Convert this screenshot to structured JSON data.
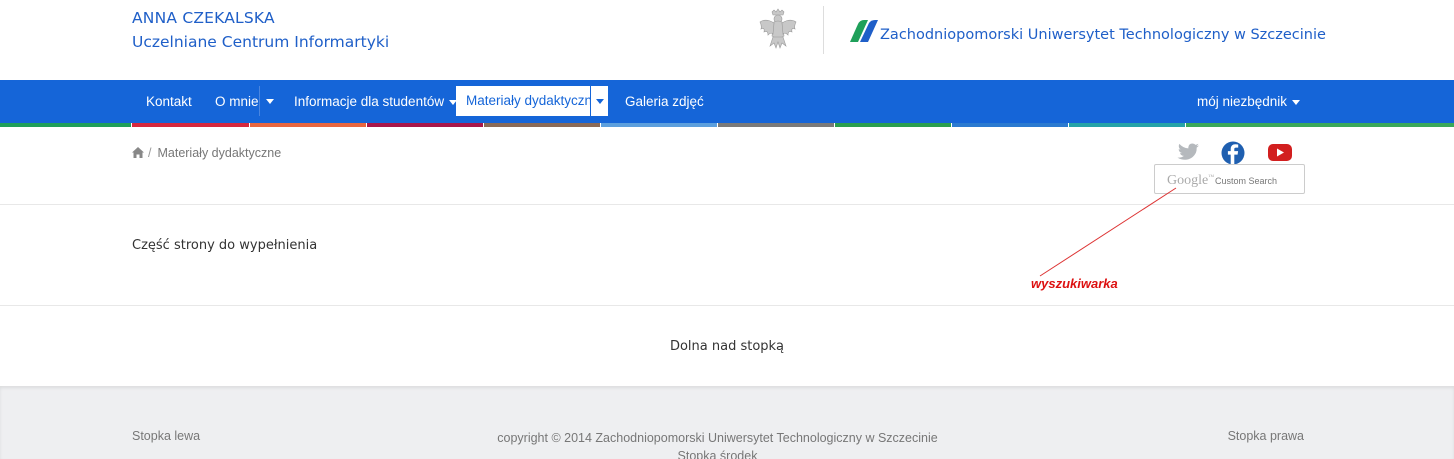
{
  "header": {
    "owner_name": "ANNA CZEKALSKA",
    "owner_unit": "Uczelniane Centrum Informartyki",
    "university": "Zachodniopomorski Uniwersytet Technologiczny w Szczecinie",
    "accent": "#1f5fc8"
  },
  "nav": {
    "background": "#1565d8",
    "items": [
      {
        "label": "Kontakt"
      },
      {
        "label": "O mnie",
        "has_split_dropdown": true
      },
      {
        "label": "Informacje dla studentów",
        "has_caret": true
      },
      {
        "label": "Materiały dydaktyczne",
        "active": true,
        "has_split_dropdown": true
      },
      {
        "label": "Galeria zdjęć"
      }
    ],
    "right_item": {
      "label": "mój niezbędnik",
      "has_caret": true
    },
    "stripe_colors": [
      "#1f9e5a",
      "#d5283e",
      "#e8663f",
      "#a8174a",
      "#8a6a57",
      "#5c9fdd",
      "#7a7a7a",
      "#2a9e4f",
      "#2b7ad0",
      "#25a3a8",
      "#3aa85a"
    ]
  },
  "breadcrumb": {
    "home_icon": "home-icon",
    "separator": "/",
    "current": "Materiały dydaktyczne"
  },
  "social": [
    {
      "name": "twitter-icon",
      "color": "#b5b9bd"
    },
    {
      "name": "facebook-icon",
      "color": "#1f5fb0"
    },
    {
      "name": "youtube-icon",
      "color": "#d21f1f"
    }
  ],
  "search": {
    "brand": "Google",
    "brand_mark": "™",
    "label": "Custom Search"
  },
  "content": {
    "text": "Część strony do wypełnienia",
    "annotation": "wyszukiwarka",
    "annotation_color": "#dd1111"
  },
  "prefooter": {
    "text": "Dolna nad stopką"
  },
  "footer": {
    "left": "Stopka lewa",
    "copyright": "copyright © 2014 Zachodniopomorski Uniwersytet Technologiczny w Szczecinie",
    "middle": "Stopka środek",
    "right": "Stopka prawa"
  }
}
